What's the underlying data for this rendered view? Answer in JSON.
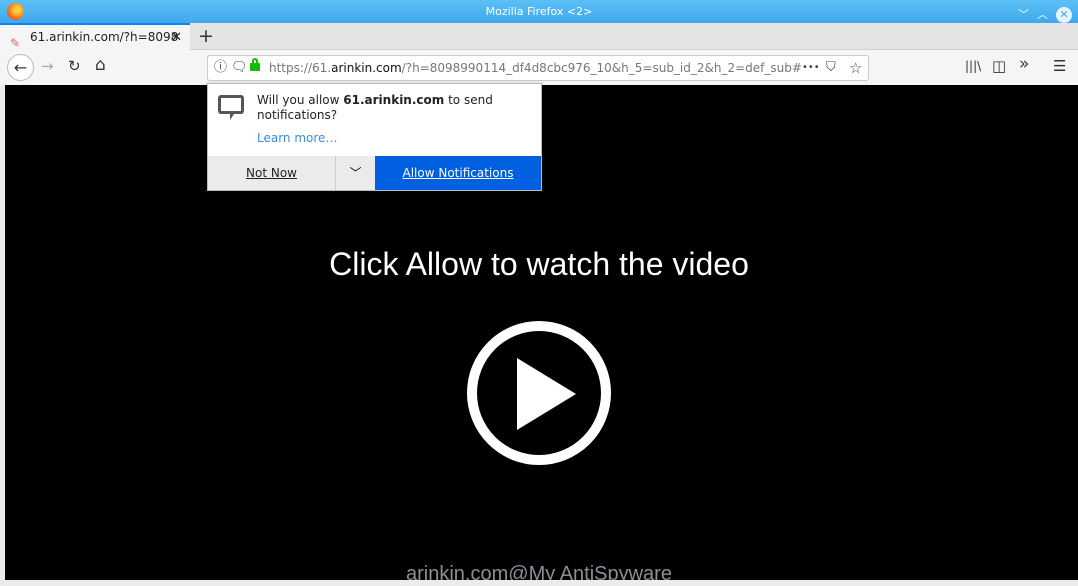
{
  "window": {
    "title": "Mozilla Firefox <2>"
  },
  "tab": {
    "title": "61.arinkin.com/?h=8098",
    "close": "✕"
  },
  "toolbar": {
    "new_tab": "+",
    "back": "←",
    "forward": "→",
    "reload": "↻",
    "home": "⌂",
    "more": "•••",
    "library": "|||\\",
    "sidebar": "◫",
    "overflow": "»",
    "menu": "☰"
  },
  "url": {
    "prefix": "https://61.",
    "domain": "arinkin.com",
    "suffix": "/?h=8098990114_df4d8cbc976_10&h_5=sub_id_2&h_2=def_sub#"
  },
  "popup": {
    "msg_pre": "Will you allow ",
    "msg_site": "61.arinkin.com",
    "msg_post": " to send notifications?",
    "learn_more": "Learn more…",
    "not_now": "Not Now",
    "allow": "Allow Notifications"
  },
  "page": {
    "headline": "Click Allow to watch the video",
    "watermark": "arinkin.com@My AntiSpyware"
  },
  "colors": {
    "accent": "#0060df",
    "titlebar": "#3fa9ec"
  }
}
